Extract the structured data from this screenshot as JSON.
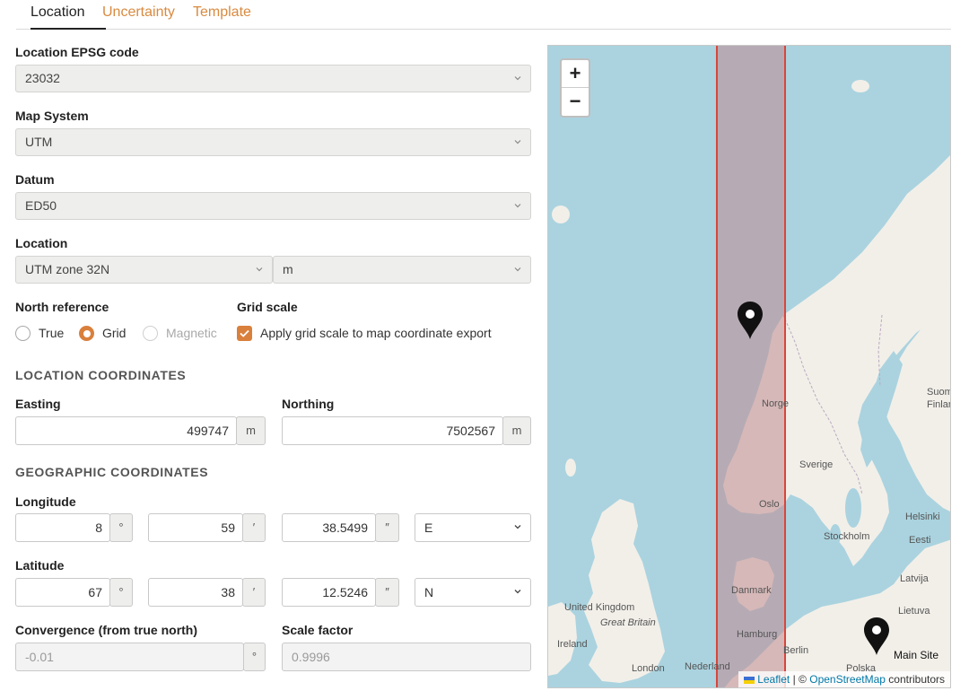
{
  "tabs": [
    {
      "label": "Location",
      "active": true
    },
    {
      "label": "Uncertainty",
      "active": false
    },
    {
      "label": "Template",
      "active": false
    }
  ],
  "location_epsg": {
    "label": "Location EPSG code",
    "value": "23032"
  },
  "map_system": {
    "label": "Map System",
    "value": "UTM"
  },
  "datum": {
    "label": "Datum",
    "value": "ED50"
  },
  "location": {
    "label": "Location",
    "zone": "UTM zone 32N",
    "unit": "m"
  },
  "north_reference": {
    "label": "North reference",
    "options": [
      {
        "label": "True",
        "selected": false,
        "disabled": false
      },
      {
        "label": "Grid",
        "selected": true,
        "disabled": false
      },
      {
        "label": "Magnetic",
        "selected": false,
        "disabled": true
      }
    ]
  },
  "grid_scale": {
    "label": "Grid scale",
    "checkbox_label": "Apply grid scale to map coordinate export",
    "checked": true
  },
  "location_coordinates": {
    "heading": "LOCATION COORDINATES",
    "easting": {
      "label": "Easting",
      "value": "499747",
      "unit": "m"
    },
    "northing": {
      "label": "Northing",
      "value": "7502567",
      "unit": "m"
    }
  },
  "geographic_coordinates": {
    "heading": "GEOGRAPHIC COORDINATES",
    "longitude": {
      "label": "Longitude",
      "deg": "8",
      "min": "59",
      "sec": "38.5499",
      "hemi": "E"
    },
    "latitude": {
      "label": "Latitude",
      "deg": "67",
      "min": "38",
      "sec": "12.5246",
      "hemi": "N"
    },
    "deg_symbol": "°",
    "min_symbol": "′",
    "sec_symbol": "″"
  },
  "convergence": {
    "label": "Convergence (from true north)",
    "value": "-0.01",
    "unit": "°"
  },
  "scale_factor": {
    "label": "Scale factor",
    "value": "0.9996"
  },
  "map": {
    "zoom_in": "+",
    "zoom_out": "−",
    "attribution": {
      "leaflet": "Leaflet",
      "sep": "|",
      "copy": "©",
      "osm": "OpenStreetMap",
      "contributors": "contributors"
    },
    "marker_label": "Main Site",
    "place_labels": [
      "Norge",
      "Sverige",
      "Suomi",
      "Finland",
      "Oslo",
      "Stockholm",
      "Helsinki",
      "Eesti",
      "Latvija",
      "Lietuva",
      "Danmark",
      "United Kingdom",
      "Great Britain",
      "Ireland",
      "London",
      "Hamburg",
      "Nederland",
      "Berlin",
      "Polska"
    ],
    "zone_fill": "#c09090",
    "zone_line": "#d9453a"
  },
  "colors": {
    "accent": "#d9803c",
    "water": "#aad3df",
    "land": "#f2efe9"
  }
}
